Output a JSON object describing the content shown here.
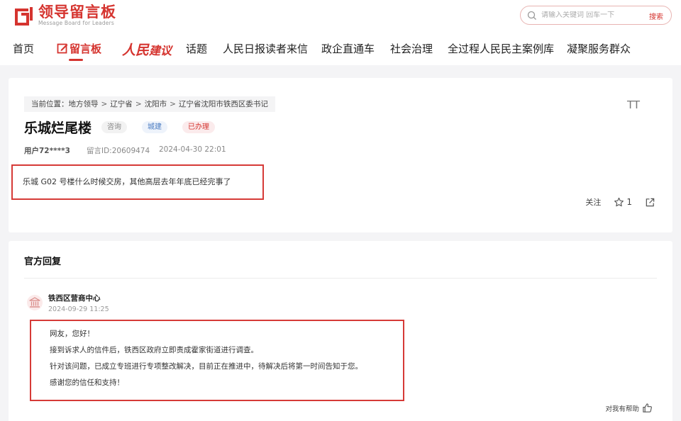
{
  "header": {
    "logo_cn": "领导留言板",
    "logo_en": "Message Board for Leaders",
    "search_placeholder": "请输入关键词 回车一下",
    "search_button": "搜索"
  },
  "nav": {
    "items": [
      "首页",
      "留言板",
      "建议",
      "话题",
      "人民日报读者来信",
      "政企直通车",
      "社会治理",
      "全过程人民民主案例库",
      "凝聚服务群众"
    ],
    "jianyi_prefix": "人民"
  },
  "breadcrumb": {
    "prefix": "当前位置：",
    "items": [
      "地方领导",
      "辽宁省",
      "沈阳市",
      "辽宁省沈阳市铁西区委书记"
    ],
    "sep": ">"
  },
  "message": {
    "title": "乐城烂尾楼",
    "tags": [
      "咨询",
      "城建",
      "已办理"
    ],
    "user": "用户72****3",
    "id_label": "留言ID:20609474",
    "time": "2024-04-30 22:01",
    "content": "乐城 G02 号楼什么时候交房，其他高层去年年底已经完事了",
    "font_size_icon": "TT",
    "follow": "关注",
    "like_count": "1"
  },
  "reply": {
    "section_title": "官方回复",
    "org": "铁西区营商中心",
    "time": "2024-09-29 11:25",
    "lines": [
      "网友，您好！",
      "接到诉求人的信件后，铁西区政府立即责成霍家街道进行调查。",
      "针对该问题，已成立专班进行专项整改解决，目前正在推进中，待解决后将第一时间告知于您。",
      "感谢您的信任和支持！"
    ],
    "helpful": "对我有帮助"
  },
  "colors": {
    "brand_red": "#d5342f",
    "highlight_border": "#d63a37",
    "tag_blue": "#4a7bc1"
  },
  "icons": [
    "logo-icon",
    "search-icon",
    "edit-icon",
    "font-size-icon",
    "star-icon",
    "share-icon",
    "bank-icon",
    "thumbs-up-icon"
  ]
}
